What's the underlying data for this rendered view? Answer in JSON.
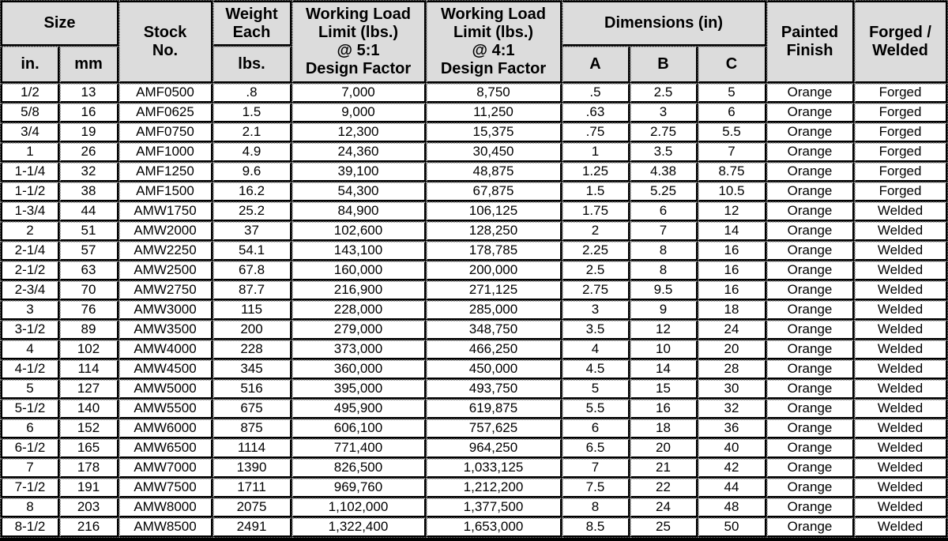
{
  "headers": {
    "size": "Size",
    "size_in": "in.",
    "size_mm": "mm",
    "stock_line1": "Stock",
    "stock_line2": "No.",
    "weight_line1": "Weight",
    "weight_line2": "Each",
    "weight_unit": "lbs.",
    "wll5_line1": "Working Load",
    "wll5_line2": "Limit (lbs.)",
    "wll5_line3": "@ 5:1",
    "wll5_line4": "Design Factor",
    "wll4_line1": "Working Load",
    "wll4_line2": "Limit (lbs.)",
    "wll4_line3": "@ 4:1",
    "wll4_line4": "Design Factor",
    "dimensions": "Dimensions (in)",
    "dim_a": "A",
    "dim_b": "B",
    "dim_c": "C",
    "painted_line1": "Painted",
    "painted_line2": "Finish",
    "forged_line1": "Forged /",
    "forged_line2": "Welded"
  },
  "rows": [
    [
      "1/2",
      "13",
      "AMF0500",
      ".8",
      "7,000",
      "8,750",
      ".5",
      "2.5",
      "5",
      "Orange",
      "Forged"
    ],
    [
      "5/8",
      "16",
      "AMF0625",
      "1.5",
      "9,000",
      "11,250",
      ".63",
      "3",
      "6",
      "Orange",
      "Forged"
    ],
    [
      "3/4",
      "19",
      "AMF0750",
      "2.1",
      "12,300",
      "15,375",
      ".75",
      "2.75",
      "5.5",
      "Orange",
      "Forged"
    ],
    [
      "1",
      "26",
      "AMF1000",
      "4.9",
      "24,360",
      "30,450",
      "1",
      "3.5",
      "7",
      "Orange",
      "Forged"
    ],
    [
      "1-1/4",
      "32",
      "AMF1250",
      "9.6",
      "39,100",
      "48,875",
      "1.25",
      "4.38",
      "8.75",
      "Orange",
      "Forged"
    ],
    [
      "1-1/2",
      "38",
      "AMF1500",
      "16.2",
      "54,300",
      "67,875",
      "1.5",
      "5.25",
      "10.5",
      "Orange",
      "Forged"
    ],
    [
      "1-3/4",
      "44",
      "AMW1750",
      "25.2",
      "84,900",
      "106,125",
      "1.75",
      "6",
      "12",
      "Orange",
      "Welded"
    ],
    [
      "2",
      "51",
      "AMW2000",
      "37",
      "102,600",
      "128,250",
      "2",
      "7",
      "14",
      "Orange",
      "Welded"
    ],
    [
      "2-1/4",
      "57",
      "AMW2250",
      "54.1",
      "143,100",
      "178,785",
      "2.25",
      "8",
      "16",
      "Orange",
      "Welded"
    ],
    [
      "2-1/2",
      "63",
      "AMW2500",
      "67.8",
      "160,000",
      "200,000",
      "2.5",
      "8",
      "16",
      "Orange",
      "Welded"
    ],
    [
      "2-3/4",
      "70",
      "AMW2750",
      "87.7",
      "216,900",
      "271,125",
      "2.75",
      "9.5",
      "16",
      "Orange",
      "Welded"
    ],
    [
      "3",
      "76",
      "AMW3000",
      "115",
      "228,000",
      "285,000",
      "3",
      "9",
      "18",
      "Orange",
      "Welded"
    ],
    [
      "3-1/2",
      "89",
      "AMW3500",
      "200",
      "279,000",
      "348,750",
      "3.5",
      "12",
      "24",
      "Orange",
      "Welded"
    ],
    [
      "4",
      "102",
      "AMW4000",
      "228",
      "373,000",
      "466,250",
      "4",
      "10",
      "20",
      "Orange",
      "Welded"
    ],
    [
      "4-1/2",
      "114",
      "AMW4500",
      "345",
      "360,000",
      "450,000",
      "4.5",
      "14",
      "28",
      "Orange",
      "Welded"
    ],
    [
      "5",
      "127",
      "AMW5000",
      "516",
      "395,000",
      "493,750",
      "5",
      "15",
      "30",
      "Orange",
      "Welded"
    ],
    [
      "5-1/2",
      "140",
      "AMW5500",
      "675",
      "495,900",
      "619,875",
      "5.5",
      "16",
      "32",
      "Orange",
      "Welded"
    ],
    [
      "6",
      "152",
      "AMW6000",
      "875",
      "606,100",
      "757,625",
      "6",
      "18",
      "36",
      "Orange",
      "Welded"
    ],
    [
      "6-1/2",
      "165",
      "AMW6500",
      "1114",
      "771,400",
      "964,250",
      "6.5",
      "20",
      "40",
      "Orange",
      "Welded"
    ],
    [
      "7",
      "178",
      "AMW7000",
      "1390",
      "826,500",
      "1,033,125",
      "7",
      "21",
      "42",
      "Orange",
      "Welded"
    ],
    [
      "7-1/2",
      "191",
      "AMW7500",
      "1711",
      "969,760",
      "1,212,200",
      "7.5",
      "22",
      "44",
      "Orange",
      "Welded"
    ],
    [
      "8",
      "203",
      "AMW8000",
      "2075",
      "1,102,000",
      "1,377,500",
      "8",
      "24",
      "48",
      "Orange",
      "Welded"
    ],
    [
      "8-1/2",
      "216",
      "AMW8500",
      "2491",
      "1,322,400",
      "1,653,000",
      "8.5",
      "25",
      "50",
      "Orange",
      "Welded"
    ]
  ]
}
